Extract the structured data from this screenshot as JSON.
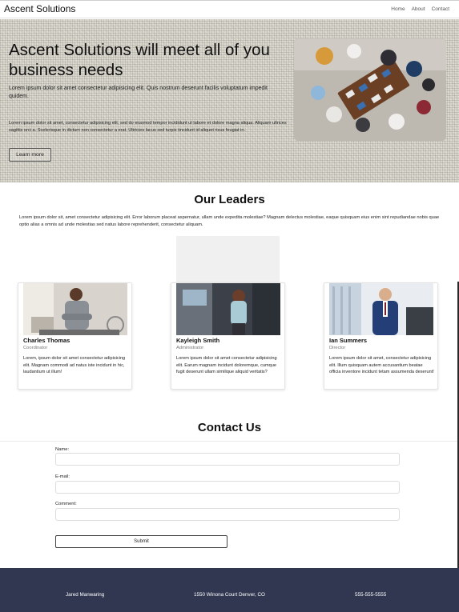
{
  "nav": {
    "brand": "Ascent Solutions",
    "links": [
      "Home",
      "About",
      "Contact"
    ]
  },
  "hero": {
    "title": "Ascent Solutions will meet all of you business needs",
    "lead": "Lorem ipsum dolor sit amet consectetur adipisicing elit. Quis nostrum deserunt facilis voluptatum impedit quidem.",
    "body": "Lorem ipsum dolor sit amet, consectetur adipisicing elit, sed do eiusmod tempor incididunt ut labore et dolore magna aliqua. Aliquam ultrices sagittis orci a. Scelerisque in dictum non consectetur a erat. Ultricies lacus sed turpis tincidunt id aliquet risus feugiat in.",
    "button": "Learn more",
    "image": "team-meeting-photo"
  },
  "leaders": {
    "title": "Our Leaders",
    "intro": "Lorem ipsum dolor sit, amet consectetur adipisicing elit. Error laborum placeat aspernatur, ullam unde expedita molestiae? Magnam delectus molestiae, eaque quisquam eius enim sint repudiandae nobis quae optio alias a omnis ad unde molestias sed natus labore reprehenderit, consectetur aliquam.",
    "cards": [
      {
        "name": "Charles Thomas",
        "role": "Coordinator",
        "text": "Lorem, ipsum dolor sit amet consectetur adipisicing elit. Magnam commodi ad natus iste incidunt in hic, laudantium ut illum!",
        "image": "man-office-portrait"
      },
      {
        "name": "Kayleigh Smith",
        "role": "Administrator",
        "text": "Lorem ipsum dolor sit amet consectetur adipisicing elit. Earum magnam incidunt doloremque, cumque fugit deserunt ullam similique aliquid veritatis?",
        "image": "woman-office-portrait"
      },
      {
        "name": "Ian Summers",
        "role": "Director",
        "text": "Lorem ipsum dolor sit amet, consectetur adipisicing elit. Illum quisquam autem accusantium beatae officia inventore incidunt tetam assumenda deserunt!",
        "image": "man-suit-portrait"
      }
    ]
  },
  "contact": {
    "title": "Contact Us",
    "name_label": "Name:",
    "email_label": "E-mail:",
    "comment_label": "Comment:",
    "submit": "Submit"
  },
  "footer": {
    "name": "Jared Manwaring",
    "address": "1550 Winona Court Denver, CO",
    "phone": "555-555-5555"
  },
  "colors": {
    "footer_bg": "#313751",
    "hero_bg": "#d9d6cc"
  }
}
